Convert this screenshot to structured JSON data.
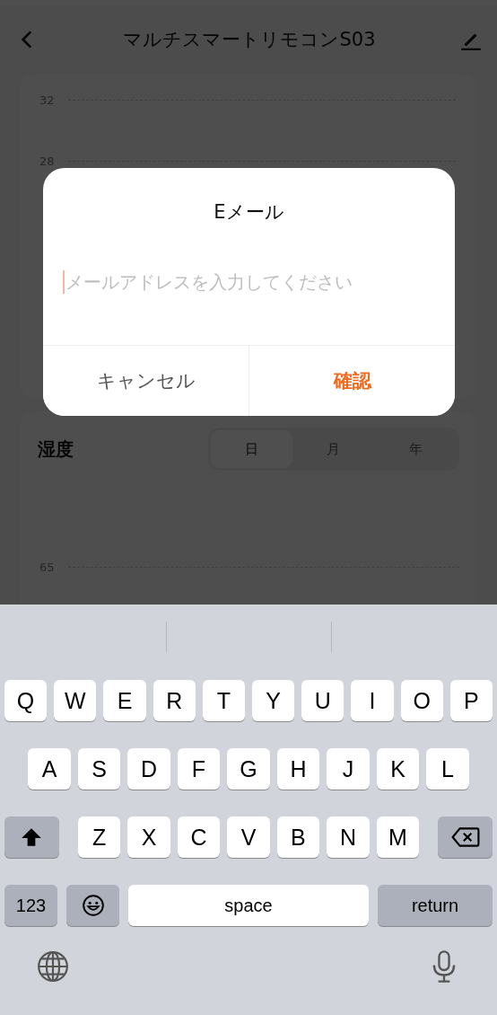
{
  "header": {
    "title": "マルチスマートリモコンS03"
  },
  "temperature_card": {
    "tick_labels": [
      "32",
      "28"
    ]
  },
  "humidity_card": {
    "title": "湿度",
    "tabs": [
      {
        "label": "日",
        "selected": true
      },
      {
        "label": "月",
        "selected": false
      },
      {
        "label": "年",
        "selected": false
      }
    ],
    "tick_labels": [
      "65"
    ]
  },
  "dialog": {
    "title": "Eメール",
    "placeholder": "メールアドレスを入力してください",
    "buttons": [
      {
        "label": "キャンセル",
        "kind": "cancel"
      },
      {
        "label": "確認",
        "kind": "confirm"
      }
    ]
  },
  "keyboard": {
    "top_row": [
      {
        "kind": "letter",
        "label": "Q"
      },
      {
        "kind": "letter",
        "label": "W"
      },
      {
        "kind": "letter",
        "label": "E"
      },
      {
        "kind": "letter",
        "label": "R"
      },
      {
        "kind": "letter",
        "label": "T"
      },
      {
        "kind": "letter",
        "label": "Y"
      },
      {
        "kind": "letter",
        "label": "U"
      },
      {
        "kind": "letter",
        "label": "I"
      },
      {
        "kind": "letter",
        "label": "O"
      },
      {
        "kind": "letter",
        "label": "P"
      }
    ],
    "home_row": [
      {
        "kind": "letter",
        "label": "A"
      },
      {
        "kind": "letter",
        "label": "S"
      },
      {
        "kind": "letter",
        "label": "D"
      },
      {
        "kind": "letter",
        "label": "F"
      },
      {
        "kind": "letter",
        "label": "G"
      },
      {
        "kind": "letter",
        "label": "H"
      },
      {
        "kind": "letter",
        "label": "J"
      },
      {
        "kind": "letter",
        "label": "K"
      },
      {
        "kind": "letter",
        "label": "L"
      }
    ],
    "lower_row": [
      {
        "kind": "shift"
      },
      {
        "kind": "letter",
        "label": "Z"
      },
      {
        "kind": "letter",
        "label": "X"
      },
      {
        "kind": "letter",
        "label": "C"
      },
      {
        "kind": "letter",
        "label": "V"
      },
      {
        "kind": "letter",
        "label": "B"
      },
      {
        "kind": "letter",
        "label": "N"
      },
      {
        "kind": "letter",
        "label": "M"
      },
      {
        "kind": "backspace"
      }
    ],
    "function_row": [
      {
        "kind": "numbers",
        "label": "123"
      },
      {
        "kind": "emoji"
      },
      {
        "kind": "space",
        "label": "space"
      },
      {
        "kind": "return",
        "label": "return"
      }
    ]
  }
}
